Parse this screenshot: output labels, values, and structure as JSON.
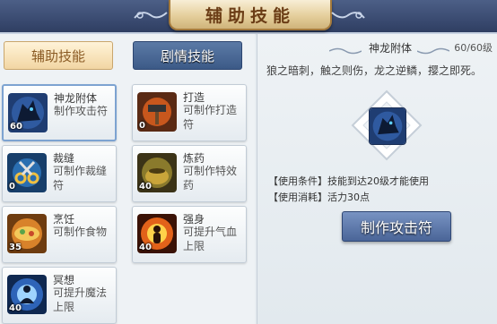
{
  "header": {
    "title": "辅助技能"
  },
  "tabs": [
    {
      "label": "辅助技能",
      "active": true
    },
    {
      "label": "剧情技能",
      "active": false
    }
  ],
  "skills": [
    {
      "name": "神龙附体",
      "desc": "制作攻击符",
      "level": "60",
      "icon": "dragon-head-icon",
      "selected": true
    },
    {
      "name": "打造",
      "desc": "可制作打造符",
      "level": "0",
      "icon": "anvil-hammer-icon"
    },
    {
      "name": "裁缝",
      "desc": "可制作裁缝符",
      "level": "0",
      "icon": "scissors-icon"
    },
    {
      "name": "炼药",
      "desc": "可制作特效药",
      "level": "40",
      "icon": "alchemy-cauldron-icon"
    },
    {
      "name": "烹饪",
      "desc": "可制作食物",
      "level": "35",
      "icon": "food-bowl-icon"
    },
    {
      "name": "强身",
      "desc": "可提升气血上限",
      "level": "40",
      "icon": "fire-body-icon"
    },
    {
      "name": "冥想",
      "desc": "可提升魔法上限",
      "level": "40",
      "icon": "meditation-icon"
    }
  ],
  "detail": {
    "name": "神龙附体",
    "level": "60/60级",
    "poem": "狼之暗刺，触之则伤，龙之逆鳞，撄之即死。",
    "condition_label": "【使用条件】",
    "condition": "技能到达20级才能使用",
    "cost_label": "【使用消耗】",
    "cost": "活力30点",
    "action": "制作攻击符"
  },
  "colors": {
    "accent": "#4a6598",
    "title_gold": "#e5cf9c",
    "header_bg": "#2f3e62"
  }
}
